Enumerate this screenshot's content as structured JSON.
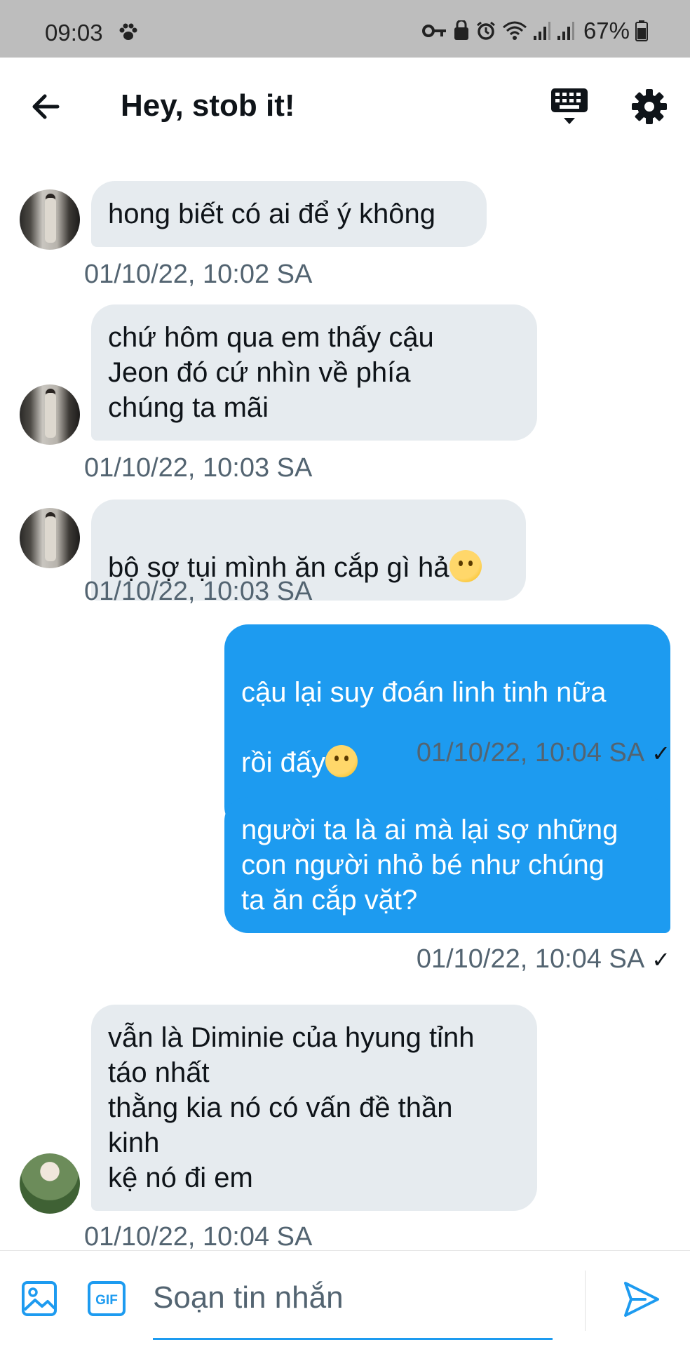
{
  "status_bar": {
    "time": "09:03",
    "battery": "67%",
    "left_icon": "paw-icon",
    "right_icons": [
      "key-icon",
      "recycle-lock-icon",
      "alarm-icon",
      "wifi-icon",
      "signal-icon",
      "signal-icon",
      "battery-icon"
    ]
  },
  "header": {
    "title": "Hey, stob it!",
    "back_icon": "arrow-left-icon",
    "keyboard_icon": "keyboard-hide-icon",
    "settings_icon": "gear-icon"
  },
  "messages": [
    {
      "direction": "incoming",
      "text": "hong biết có ai để ý không",
      "time": "01/10/22, 10:02 SA"
    },
    {
      "direction": "incoming",
      "text": "chứ hôm qua em thấy cậu\nJeon đó cứ nhìn về phía\nchúng ta mãi",
      "time": "01/10/22, 10:03 SA"
    },
    {
      "direction": "incoming",
      "text": "bộ sợ tụi mình ăn cắp gì hả",
      "emoji": "thinking-face-emoji",
      "time": "01/10/22, 10:03 SA"
    },
    {
      "direction": "outgoing",
      "text_line1": "cậu lại suy đoán linh tinh nữa",
      "text_line2": "rồi đấy",
      "emoji": "facepalm-emoji",
      "time": "01/10/22, 10:04 SA",
      "status": "✓"
    },
    {
      "direction": "outgoing",
      "text": "người ta là ai mà lại sợ những\ncon người nhỏ bé như chúng\nta ăn cắp vặt?",
      "time": "01/10/22, 10:04 SA",
      "status": "✓"
    },
    {
      "direction": "incoming",
      "text": "vẫn là Diminie của hyung tỉnh\ntáo nhất\nthằng kia nó có vấn đề thần\nkinh\nkệ nó đi em",
      "time": "01/10/22, 10:04 SA"
    }
  ],
  "composer": {
    "placeholder": "Soạn tin nhắn",
    "gif_label": "GIF",
    "media_icon": "image-icon",
    "send_icon": "send-icon"
  },
  "colors": {
    "accent": "#1d9bf0",
    "incoming_bubble": "#e6ebef",
    "timestamp": "#536471",
    "status_bar": "#bdbdbd"
  }
}
